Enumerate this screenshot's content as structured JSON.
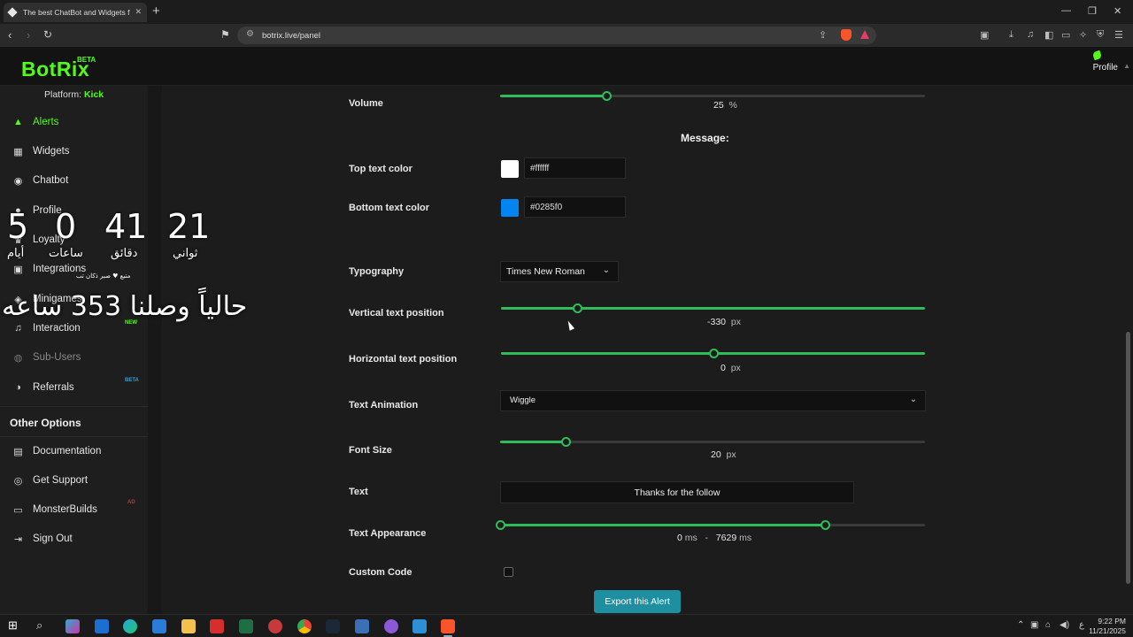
{
  "browser": {
    "tab_title": "The best ChatBot and Widgets f",
    "url": "botrix.live/panel",
    "new_tab_icon": "plus-icon"
  },
  "header": {
    "logo": "BotRix",
    "logo_badge": "BETA",
    "profile_label": "Profile"
  },
  "sidebar": {
    "platform_label": "Platform:",
    "platform_value": "Kick",
    "items": [
      {
        "label": "Alerts",
        "icon": "bell-icon",
        "active": true
      },
      {
        "label": "Widgets",
        "icon": "grid-icon"
      },
      {
        "label": "Chatbot",
        "icon": "robot-icon"
      },
      {
        "label": "Profile",
        "icon": "user-icon"
      },
      {
        "label": "Loyalty",
        "icon": "trophy-icon"
      },
      {
        "label": "Integrations",
        "icon": "link-icon"
      },
      {
        "label": "Minigames",
        "icon": "gamepad-icon"
      },
      {
        "label": "Interaction",
        "icon": "music-icon",
        "badge": "NEW"
      },
      {
        "label": "Sub-Users",
        "icon": "users-icon"
      },
      {
        "label": "Referrals",
        "icon": "referral-icon",
        "badge": "BETA"
      }
    ],
    "other_heading": "Other Options",
    "other_items": [
      {
        "label": "Documentation",
        "icon": "document-icon"
      },
      {
        "label": "Get Support",
        "icon": "support-icon"
      },
      {
        "label": "MonsterBuilds",
        "icon": "laptop-icon",
        "badge": "AD"
      },
      {
        "label": "Sign Out",
        "icon": "signout-icon"
      }
    ]
  },
  "overlay": {
    "countdown": [
      {
        "value": "5",
        "label": "أيام"
      },
      {
        "value": "0",
        "label": "ساعات"
      },
      {
        "value": "41",
        "label": "دقائق"
      },
      {
        "value": "21",
        "label": "ثواني"
      }
    ],
    "small_text": "متبع ♥ صبر ذكان تب",
    "big_text": "حالياً وصلنا 353 ساعه"
  },
  "form": {
    "volume": {
      "label": "Volume",
      "value": 25,
      "unit": "%"
    },
    "message_heading": "Message:",
    "top_text_color": {
      "label": "Top text color",
      "hex": "#ffffff"
    },
    "bottom_text_color": {
      "label": "Bottom text color",
      "hex": "#0285f0"
    },
    "typography": {
      "label": "Typography",
      "value": "Times New Roman"
    },
    "vertical_position": {
      "label": "Vertical text position",
      "value": "-330",
      "unit": "px",
      "fill_fraction": 0.18
    },
    "horizontal_position": {
      "label": "Horizontal text position",
      "value": "0",
      "unit": "px",
      "fill_fraction": 0.5
    },
    "text_animation": {
      "label": "Text Animation",
      "value": "Wiggle"
    },
    "font_size": {
      "label": "Font Size",
      "value": "20",
      "unit": "px",
      "fill_fraction": 0.155
    },
    "text": {
      "label": "Text",
      "value": "Thanks for the follow"
    },
    "text_appearance": {
      "label": "Text Appearance",
      "start": "0",
      "end": "7629",
      "unit": "ms",
      "separator": "-",
      "end_fraction": 0.765
    },
    "custom_code": {
      "label": "Custom Code",
      "checked": false
    },
    "export_button": "Export this Alert"
  },
  "taskbar": {
    "time": "9:22 PM",
    "date": "11/21/2025",
    "lang": "ع"
  }
}
